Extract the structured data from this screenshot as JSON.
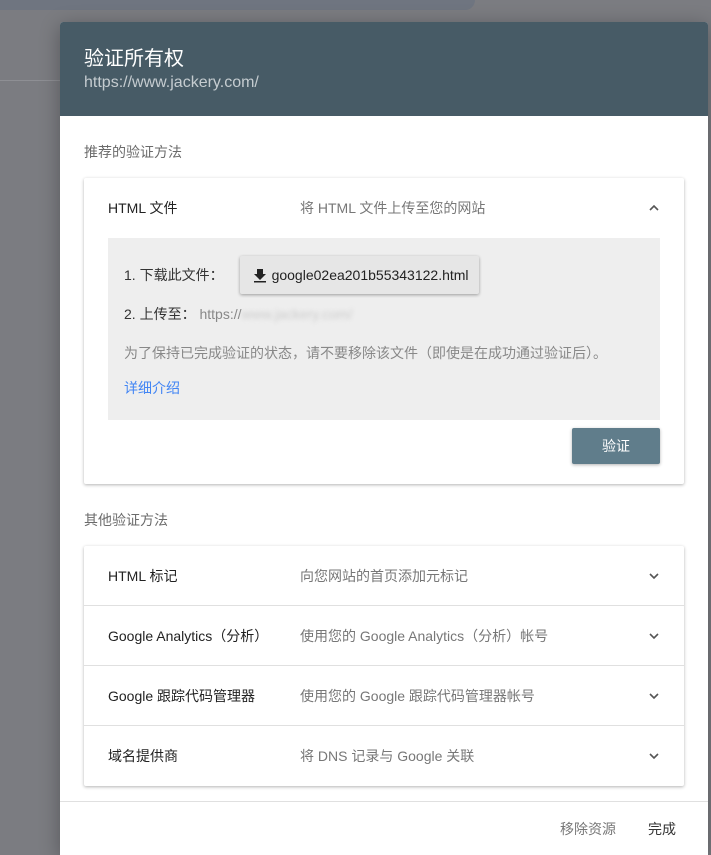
{
  "dialog": {
    "title": "验证所有权",
    "property_url": "https://www.jackery.com/"
  },
  "recommended": {
    "heading": "推荐的验证方法",
    "method": {
      "label": "HTML 文件",
      "description": "将 HTML 文件上传至您的网站",
      "step1_label": "1. 下载此文件：",
      "download_file": "google02ea201b55343122.html",
      "step2_label": "2. 上传至：",
      "upload_url_prefix": "https://",
      "upload_url_obscured": "www.jackery.com/",
      "note": "为了保持已完成验证的状态，请不要移除该文件（即使是在成功通过验证后）。",
      "learn_more": "详细介绍",
      "verify_button": "验证"
    }
  },
  "other": {
    "heading": "其他验证方法",
    "methods": [
      {
        "label": "HTML 标记",
        "description": "向您网站的首页添加元标记"
      },
      {
        "label": "Google Analytics（分析）",
        "description": "使用您的 Google Analytics（分析）帐号"
      },
      {
        "label": "Google 跟踪代码管理器",
        "description": "使用您的 Google 跟踪代码管理器帐号"
      },
      {
        "label": "域名提供商",
        "description": "将 DNS 记录与 Google 关联"
      }
    ]
  },
  "footer": {
    "remove": "移除资源",
    "done": "完成"
  }
}
